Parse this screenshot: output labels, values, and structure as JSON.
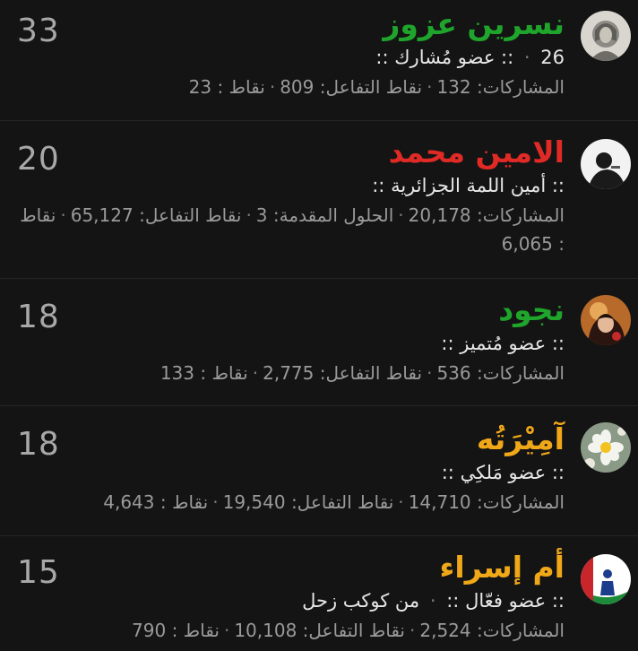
{
  "members": [
    {
      "name": "نسرين عزوز",
      "name_color": "#1fa52b",
      "title_prefix": "::",
      "title": "عضو مُشارك",
      "title_suffix": "::",
      "extra_sep": "·",
      "extra": "26",
      "posts_label": "المشاركات:",
      "posts": "132",
      "reaction_label": "نقاط التفاعل:",
      "reaction": "809",
      "points_label": "نقاط :",
      "points": "23",
      "score": "33",
      "avatar_icon": "warrior-portrait-icon"
    },
    {
      "name": "الامين محمد",
      "name_color": "#e02a26",
      "title_prefix": "::",
      "title": "أمين اللمة الجزائرية",
      "title_suffix": "::",
      "posts_label": "المشاركات:",
      "posts": "20,178",
      "solutions_label": "الحلول المقدمة:",
      "solutions": "3",
      "reaction_label": "نقاط التفاعل:",
      "reaction": "65,127",
      "points_label": "نقاط :",
      "points": "6,065",
      "score": "20",
      "avatar_icon": "person-silhouette-icon"
    },
    {
      "name": "نجود",
      "name_color": "#1fa52b",
      "title_prefix": "::",
      "title": "عضو مُتميز",
      "title_suffix": "::",
      "posts_label": "المشاركات:",
      "posts": "536",
      "reaction_label": "نقاط التفاعل:",
      "reaction": "2,775",
      "points_label": "نقاط :",
      "points": "133",
      "score": "18",
      "avatar_icon": "child-photo-icon"
    },
    {
      "name": "آمِيْرَتُه",
      "name_color": "#f0a818",
      "title_prefix": "::",
      "title": "عضو مَلكِي",
      "title_suffix": "::",
      "posts_label": "المشاركات:",
      "posts": "14,710",
      "reaction_label": "نقاط التفاعل:",
      "reaction": "19,540",
      "points_label": "نقاط :",
      "points": "4,643",
      "score": "18",
      "avatar_icon": "flower-icon"
    },
    {
      "name": "أم إسراء",
      "name_color": "#f0a818",
      "title_prefix": "::",
      "title": "عضو فعّال",
      "title_suffix": "::",
      "extra_sep": "·",
      "extra": "من كوكب زحل",
      "posts_label": "المشاركات:",
      "posts": "2,524",
      "reaction_label": "نقاط التفاعل:",
      "reaction": "10,108",
      "points_label": "نقاط :",
      "points": "790",
      "score": "15",
      "avatar_icon": "palestine-flag-icon"
    }
  ]
}
